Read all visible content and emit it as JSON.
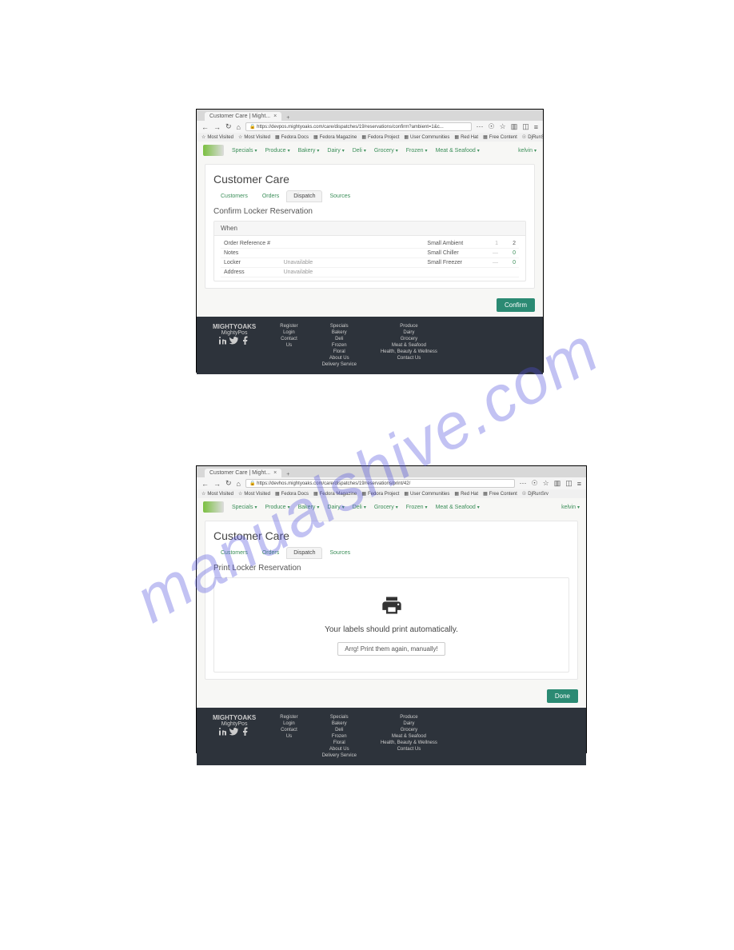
{
  "watermark": "manualshive.com",
  "browser": {
    "tab_title": "Customer Care | Might...",
    "url1": "https://devpos.mightyoaks.com/care/dispatches/19/reservations/confirm?ambient=1&c...",
    "url2": "https://devhos.mightyoaks.com/care/dispatches/19/reservations/print/42/",
    "bookmarks": [
      "Most Visited",
      "Most Visited",
      "Fedora Docs",
      "Fedora Magazine",
      "Fedora Project",
      "User Communities",
      "Red Hat",
      "Free Content",
      "DjRunSrv"
    ]
  },
  "site_nav": [
    "Specials",
    "Produce",
    "Bakery",
    "Dairy",
    "Deli",
    "Grocery",
    "Frozen",
    "Meat & Seafood"
  ],
  "admin_label": "kelvin",
  "page1": {
    "title": "Customer Care",
    "subtabs": [
      "Customers",
      "Orders",
      "Dispatch",
      "Sources"
    ],
    "subtitle": "Confirm Locker Reservation",
    "panel_head": "When",
    "rows_left": [
      {
        "label": "Order Reference #",
        "value": ""
      },
      {
        "label": "Notes",
        "value": ""
      },
      {
        "label": "Locker",
        "value": "Unavailable"
      },
      {
        "label": "Address",
        "value": "Unavailable"
      }
    ],
    "rows_right": [
      {
        "label": "Small Ambient",
        "minus": "1",
        "val": "2"
      },
      {
        "label": "Small Chiller",
        "minus": "—",
        "val": "0"
      },
      {
        "label": "Small Freezer",
        "minus": "—",
        "val": "0"
      }
    ],
    "confirm_btn": "Confirm"
  },
  "page2": {
    "title": "Customer Care",
    "subtabs": [
      "Customers",
      "Orders",
      "Dispatch",
      "Sources"
    ],
    "subtitle": "Print Locker Reservation",
    "print_msg": "Your labels should print automatically.",
    "print_again": "Arrg! Print them again, manually!",
    "done_btn": "Done"
  },
  "footer": {
    "brand1": "MIGHTYOAKS",
    "brand2": "MightyPos",
    "col1": [
      "Register",
      "Login",
      "Contact",
      "Us"
    ],
    "col2": [
      "Specials",
      "Bakery",
      "Deli",
      "Frozen",
      "Floral",
      "About Us",
      "Delivery Service"
    ],
    "col3": [
      "Produce",
      "Dairy",
      "Grocery",
      "Meat & Seafood",
      "Health, Beauty & Wellness",
      "Contact Us"
    ]
  }
}
